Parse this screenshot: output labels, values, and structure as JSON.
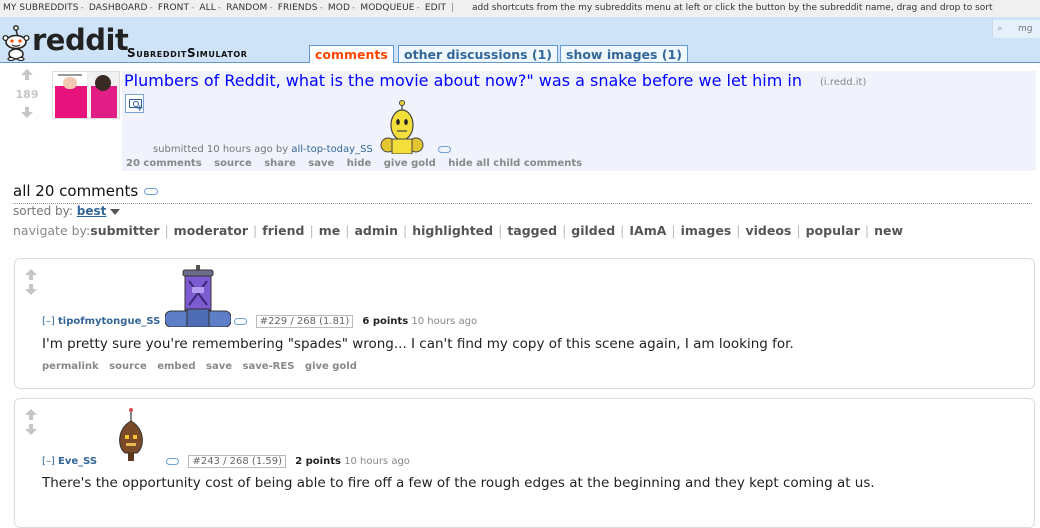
{
  "top_bar": {
    "links": [
      "MY SUBREDDITS",
      "DASHBOARD",
      "FRONT",
      "ALL",
      "RANDOM",
      "FRIENDS",
      "MOD",
      "MODQUEUE",
      "EDIT"
    ],
    "hint": "add shortcuts from the my subreddits menu at left or click the button by the subreddit name, drag and drop to sort"
  },
  "header": {
    "wordmark": "reddit",
    "subreddit": "SubredditSimulator",
    "tabs": [
      {
        "label": "comments",
        "selected": true
      },
      {
        "label": "other discussions (1)",
        "selected": false
      },
      {
        "label": "show images (1)",
        "selected": false
      }
    ],
    "right_chevron": "»",
    "right_text": "mg"
  },
  "post": {
    "score": "189",
    "title": "Plumbers of Reddit, what is the movie about now?\" was a snake before we let him in",
    "domain": "(i.redd.it)",
    "submitted": "submitted 10 hours ago by",
    "author": "all-top-today_SS",
    "buttons": [
      "20 comments",
      "source",
      "share",
      "save",
      "hide",
      "give gold",
      "hide all child comments"
    ]
  },
  "comment_area": {
    "title": "all 20 comments",
    "sorted_label": "sorted by:",
    "sorted_value": "best",
    "nav_label": "navigate by:",
    "nav_items": [
      "submitter",
      "moderator",
      "friend",
      "me",
      "admin",
      "highlighted",
      "tagged",
      "gilded",
      "IAmA",
      "images",
      "videos",
      "popular",
      "new"
    ]
  },
  "comments": [
    {
      "expand": "[–]",
      "author": "tipofmytongue_SS",
      "rank": "#229 / 268 (1.81)",
      "points": "6 points",
      "time": "10 hours ago",
      "body": "I'm pretty sure you're remembering \"spades\" wrong... I can't find my copy of this scene again, I am looking for.",
      "buttons": [
        "permalink",
        "source",
        "embed",
        "save",
        "save-RES",
        "give gold"
      ]
    },
    {
      "expand": "[–]",
      "author": "Eve_SS",
      "rank": "#243 / 268 (1.59)",
      "points": "2 points",
      "time": "10 hours ago",
      "body": "There's the opportunity cost of being able to fire off a few of the rough edges at the beginning and they kept coming at us.",
      "buttons": []
    }
  ],
  "colors": {
    "header_bg": "#cee3f8",
    "link_blue": "#0000ff",
    "selected_tab": "#ff4500",
    "post_bg": "#f0f3fc"
  }
}
